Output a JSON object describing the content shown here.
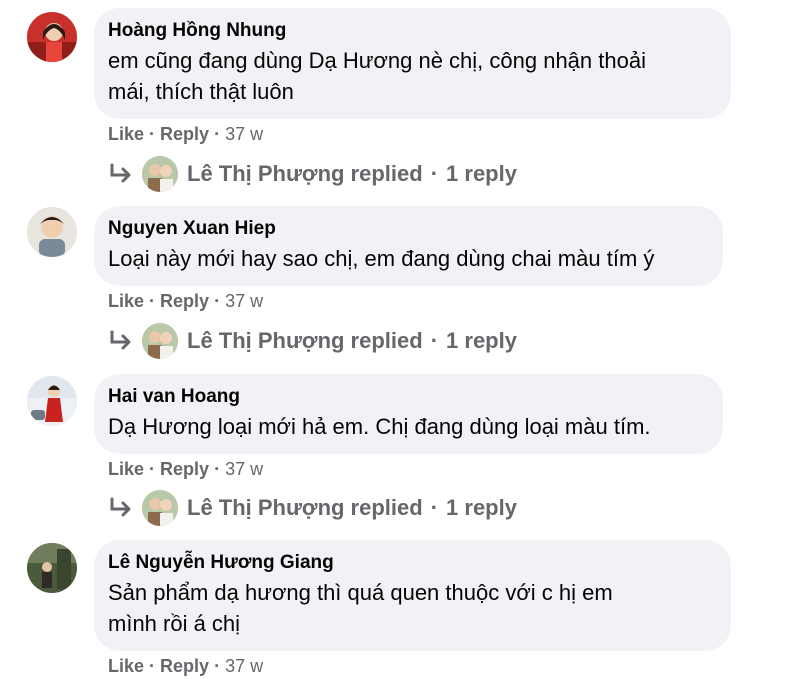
{
  "comments": [
    {
      "author": "Hoàng Hồng Nhung",
      "text": "em cũng đang dùng Dạ Hương nè chị, công nhận thoải\nmái, thích thật luôn",
      "like": "Like",
      "reply": "Reply",
      "time": "37 w",
      "replies": {
        "name": "Lê Thị Phượng replied",
        "count": "1 reply"
      }
    },
    {
      "author": "Nguyen Xuan Hiep",
      "text": "Loại này mới hay sao chị, em đang dùng chai màu tím ý",
      "like": "Like",
      "reply": "Reply",
      "time": "37 w",
      "replies": {
        "name": "Lê Thị Phượng replied",
        "count": "1 reply"
      }
    },
    {
      "author": "Hai van Hoang",
      "text": "Dạ Hương loại mới hả em. Chị đang dùng loại màu tím.",
      "like": "Like",
      "reply": "Reply",
      "time": "37 w",
      "replies": {
        "name": "Lê Thị Phượng replied",
        "count": "1 reply"
      }
    },
    {
      "author": "Lê Nguyễn Hương Giang",
      "text": "Sản phẩm dạ hương thì quá quen thuộc với c hị em\nmình rồi á chị",
      "like": "Like",
      "reply": "Reply",
      "time": "37 w"
    }
  ],
  "colors": {
    "bubble": "#f0f2f5",
    "secondary_text": "#65676b"
  },
  "icons": {
    "reply_arrow": "reply-arrow-icon"
  }
}
